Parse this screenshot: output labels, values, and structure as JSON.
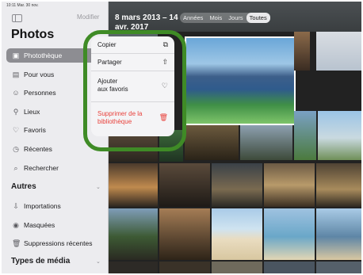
{
  "status": {
    "time": "10:11  Mar. 30 nov.",
    "right": ""
  },
  "sidebar": {
    "edit_label": "Modifier",
    "title": "Photos",
    "items": [
      {
        "label": "Photothèque",
        "icon": "photo-library-icon",
        "glyph": "▣"
      },
      {
        "label": "Pour vous",
        "icon": "for-you-icon",
        "glyph": "▤"
      },
      {
        "label": "Personnes",
        "icon": "people-icon",
        "glyph": "☺"
      },
      {
        "label": "Lieux",
        "icon": "places-icon",
        "glyph": "⚲"
      },
      {
        "label": "Favoris",
        "icon": "heart-icon",
        "glyph": "♡"
      },
      {
        "label": "Récentes",
        "icon": "clock-icon",
        "glyph": "◷"
      },
      {
        "label": "Rechercher",
        "icon": "search-icon",
        "glyph": "⌕"
      }
    ],
    "section_other": "Autres",
    "other_items": [
      {
        "label": "Importations",
        "icon": "import-icon",
        "glyph": "⇩"
      },
      {
        "label": "Masquées",
        "icon": "hidden-icon",
        "glyph": "◉"
      },
      {
        "label": "Suppressions récentes",
        "icon": "trash-icon",
        "glyph": "🗑"
      }
    ],
    "section_media": "Types de média"
  },
  "header": {
    "date_line1": "8 mars 2013 – 14",
    "date_line2": "avr. 2017",
    "tabs": [
      "Années",
      "Mois",
      "Jours",
      "Toutes"
    ],
    "selected_tab": "Toutes"
  },
  "menu": {
    "items": [
      {
        "label": "Copier",
        "icon": "copy-icon",
        "glyph": "⧉"
      },
      {
        "label": "Partager",
        "icon": "share-icon",
        "glyph": "⇧"
      },
      {
        "label": "Ajouter\naux favoris",
        "icon": "heart-icon",
        "glyph": "♡"
      },
      {
        "label": "Supprimer de la\nbibliothèque",
        "icon": "trash-icon",
        "glyph": "🗑",
        "destructive": true
      }
    ]
  },
  "colors": {
    "accent_ring": "#3f8b26",
    "destructive": "#e8413b",
    "selected_row": "#8d8d92"
  }
}
